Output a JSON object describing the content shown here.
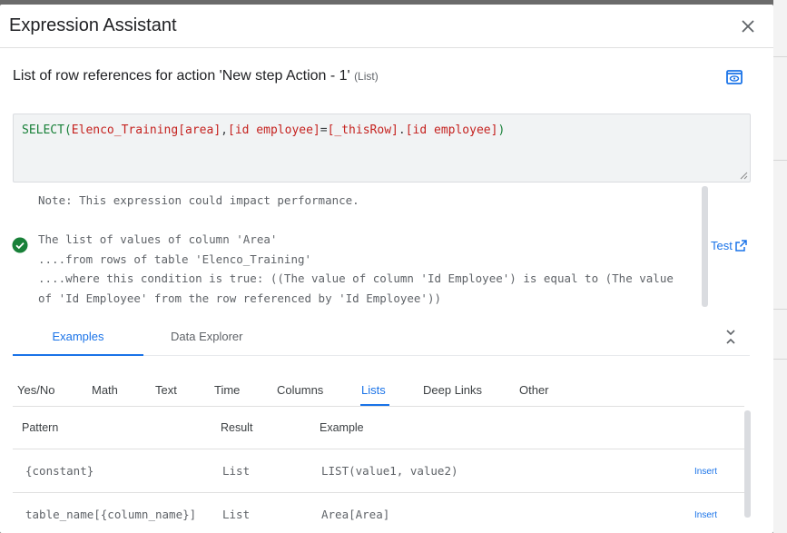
{
  "dialog": {
    "title": "Expression Assistant",
    "subtitle": "List of row references for action 'New step Action - 1'",
    "subtitle_type": "(List)"
  },
  "expression": {
    "fn_open": "SELECT(",
    "table": "Elenco_Training",
    "col1": "[area]",
    "comma": ",",
    "col2": "[id employee]",
    "eq": "=",
    "this_row": "[_thisRow]",
    "dot": ".",
    "col3": "[id employee]",
    "close": ")"
  },
  "description": {
    "note": "Note: This expression could impact performance.",
    "line1": "The list of values of column 'Area'",
    "line2": "....from rows of table 'Elenco_Training'",
    "line3": "....where this condition is true: ((The value of column 'Id Employee') is equal to (The value",
    "line4": "of 'Id Employee' from the row referenced by 'Id Employee'))"
  },
  "test_label": "Test",
  "tabs": [
    {
      "label": "Examples"
    },
    {
      "label": "Data Explorer"
    }
  ],
  "categories": [
    {
      "label": "Yes/No"
    },
    {
      "label": "Math"
    },
    {
      "label": "Text"
    },
    {
      "label": "Time"
    },
    {
      "label": "Columns"
    },
    {
      "label": "Lists"
    },
    {
      "label": "Deep Links"
    },
    {
      "label": "Other"
    }
  ],
  "table": {
    "headers": {
      "pattern": "Pattern",
      "result": "Result",
      "example": "Example"
    },
    "rows": [
      {
        "pattern": "{constant}",
        "result": "List",
        "example": "LIST(value1, value2)",
        "insert": "Insert"
      },
      {
        "pattern": "table_name[{column_name}]",
        "result": "List",
        "example": "Area[Area]",
        "insert": "Insert"
      }
    ]
  },
  "colors": {
    "accent": "#1a73e8",
    "success": "#188038",
    "code_column": "#c5221f",
    "code_thisrow": "#a142f4"
  },
  "icons": [
    "close-icon",
    "preview-icon",
    "check-circle-icon",
    "open-in-new-icon",
    "collapse-icon",
    "resize-grip-icon"
  ]
}
